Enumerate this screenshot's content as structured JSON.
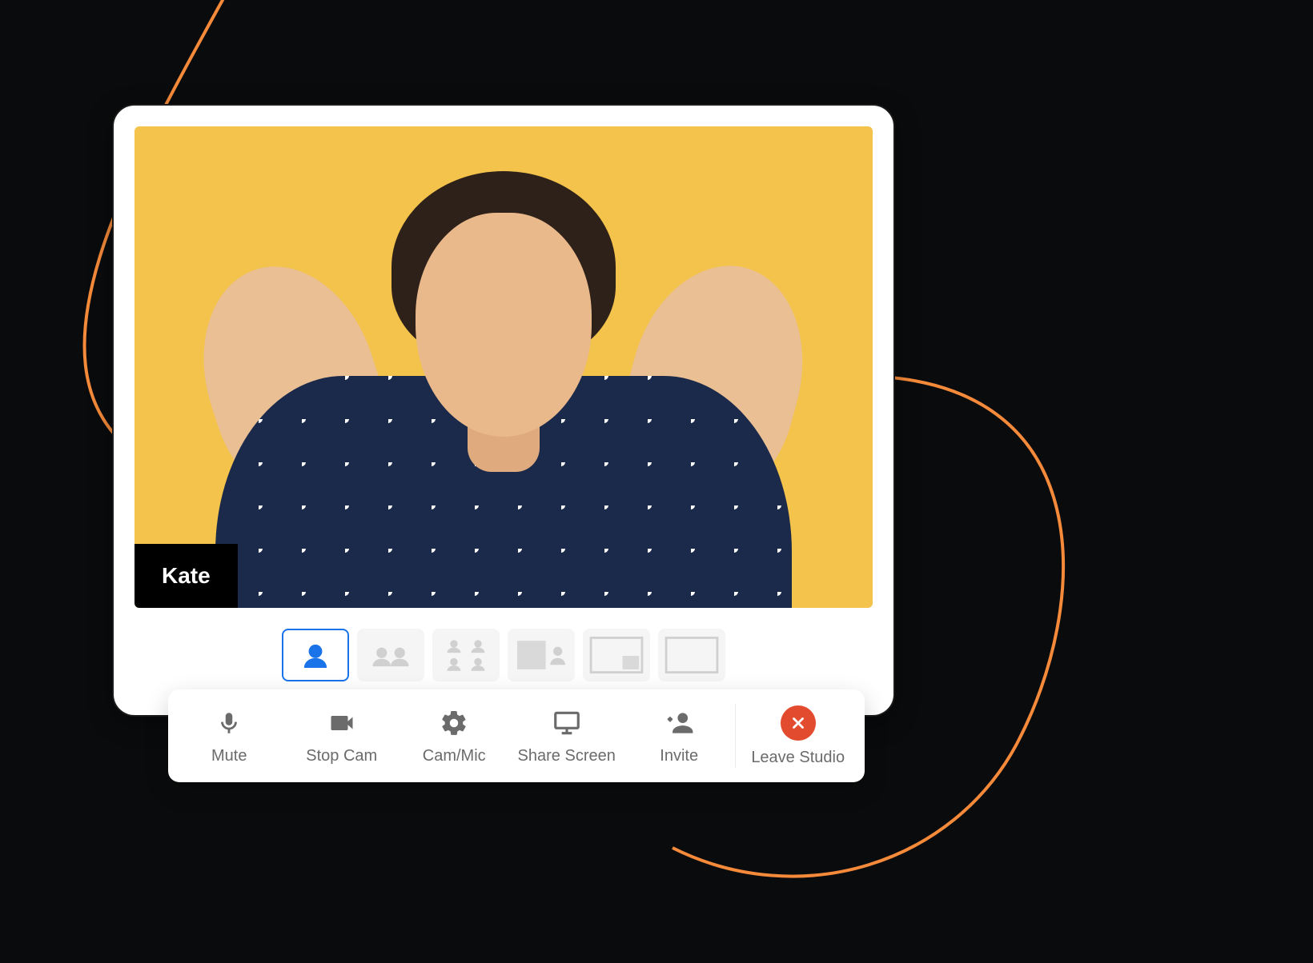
{
  "participant": {
    "name": "Kate"
  },
  "layout": {
    "selected_index": 0
  },
  "toolbar": {
    "mute": "Mute",
    "stop_cam": "Stop Cam",
    "cam_mic": "Cam/Mic",
    "share_screen": "Share Screen",
    "invite": "Invite",
    "leave": "Leave Studio"
  },
  "colors": {
    "accent": "#1a73e8",
    "video_bg": "#f3c34b",
    "leave": "#e34b2e",
    "ornament": "#f58a3a"
  }
}
